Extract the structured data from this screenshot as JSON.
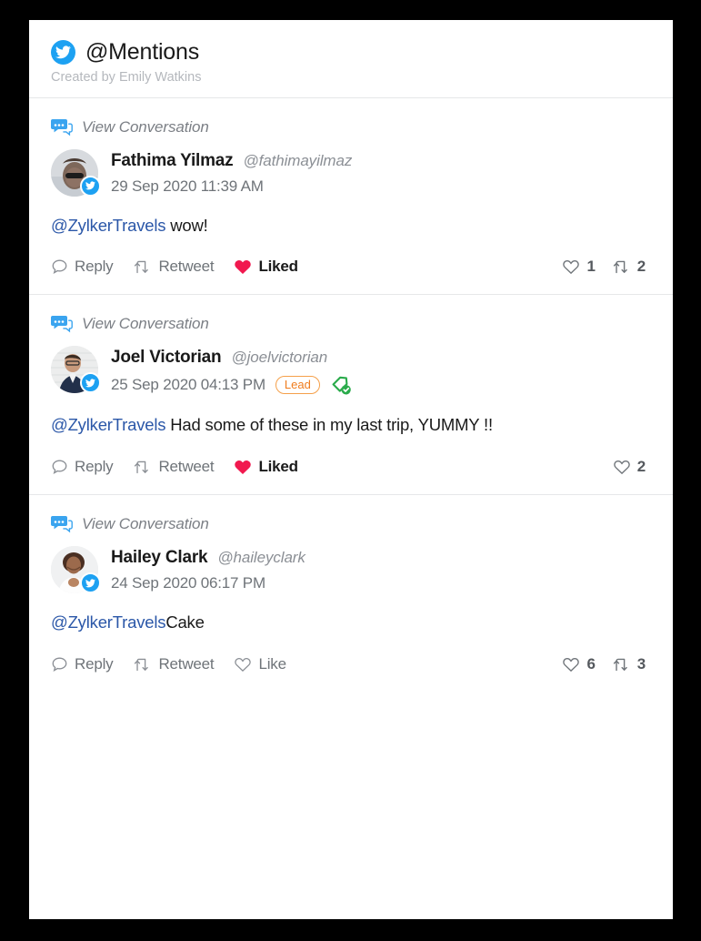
{
  "header": {
    "logo_icon": "twitter-bird-icon",
    "title": "@Mentions",
    "subtitle": "Created by Emily Watkins"
  },
  "colors": {
    "twitter_blue": "#1da1f2",
    "mention_link": "#2b57a8",
    "liked_heart": "#f1194f",
    "lead_badge": "#f07c1d",
    "deal_green": "#2aab4b",
    "muted_text": "#6f7479",
    "divider": "#e6e7e9",
    "page_background": "#000000",
    "card_background": "#ffffff"
  },
  "conversation_link_label": "View Conversation",
  "tweets": [
    {
      "conversation_label": "View Conversation",
      "author_name": "Fathima Yilmaz",
      "author_handle": "@fathimayilmaz",
      "date": "29 Sep 2020 11:39 AM",
      "badge": null,
      "has_deal_icon": false,
      "mention": "@ZylkerTravels",
      "text": " wow!",
      "actions": {
        "reply_label": "Reply",
        "retweet_label": "Retweet",
        "like_label": "Liked",
        "liked": true
      },
      "stats": {
        "likes": "1",
        "retweets": "2"
      }
    },
    {
      "conversation_label": "View Conversation",
      "author_name": "Joel Victorian",
      "author_handle": "@joelvictorian",
      "date": "25 Sep 2020 04:13 PM",
      "badge": "Lead",
      "has_deal_icon": true,
      "mention": "@ZylkerTravels",
      "text": " Had some of these in my last trip, YUMMY !!",
      "actions": {
        "reply_label": "Reply",
        "retweet_label": "Retweet",
        "like_label": "Liked",
        "liked": true
      },
      "stats": {
        "likes": "2",
        "retweets": null
      }
    },
    {
      "conversation_label": "View Conversation",
      "author_name": "Hailey Clark",
      "author_handle": "@haileyclark",
      "date": "24 Sep 2020 06:17 PM",
      "badge": null,
      "has_deal_icon": false,
      "mention": "@ZylkerTravels",
      "text": "Cake",
      "actions": {
        "reply_label": "Reply",
        "retweet_label": "Retweet",
        "like_label": "Like",
        "liked": false
      },
      "stats": {
        "likes": "6",
        "retweets": "3"
      }
    }
  ]
}
